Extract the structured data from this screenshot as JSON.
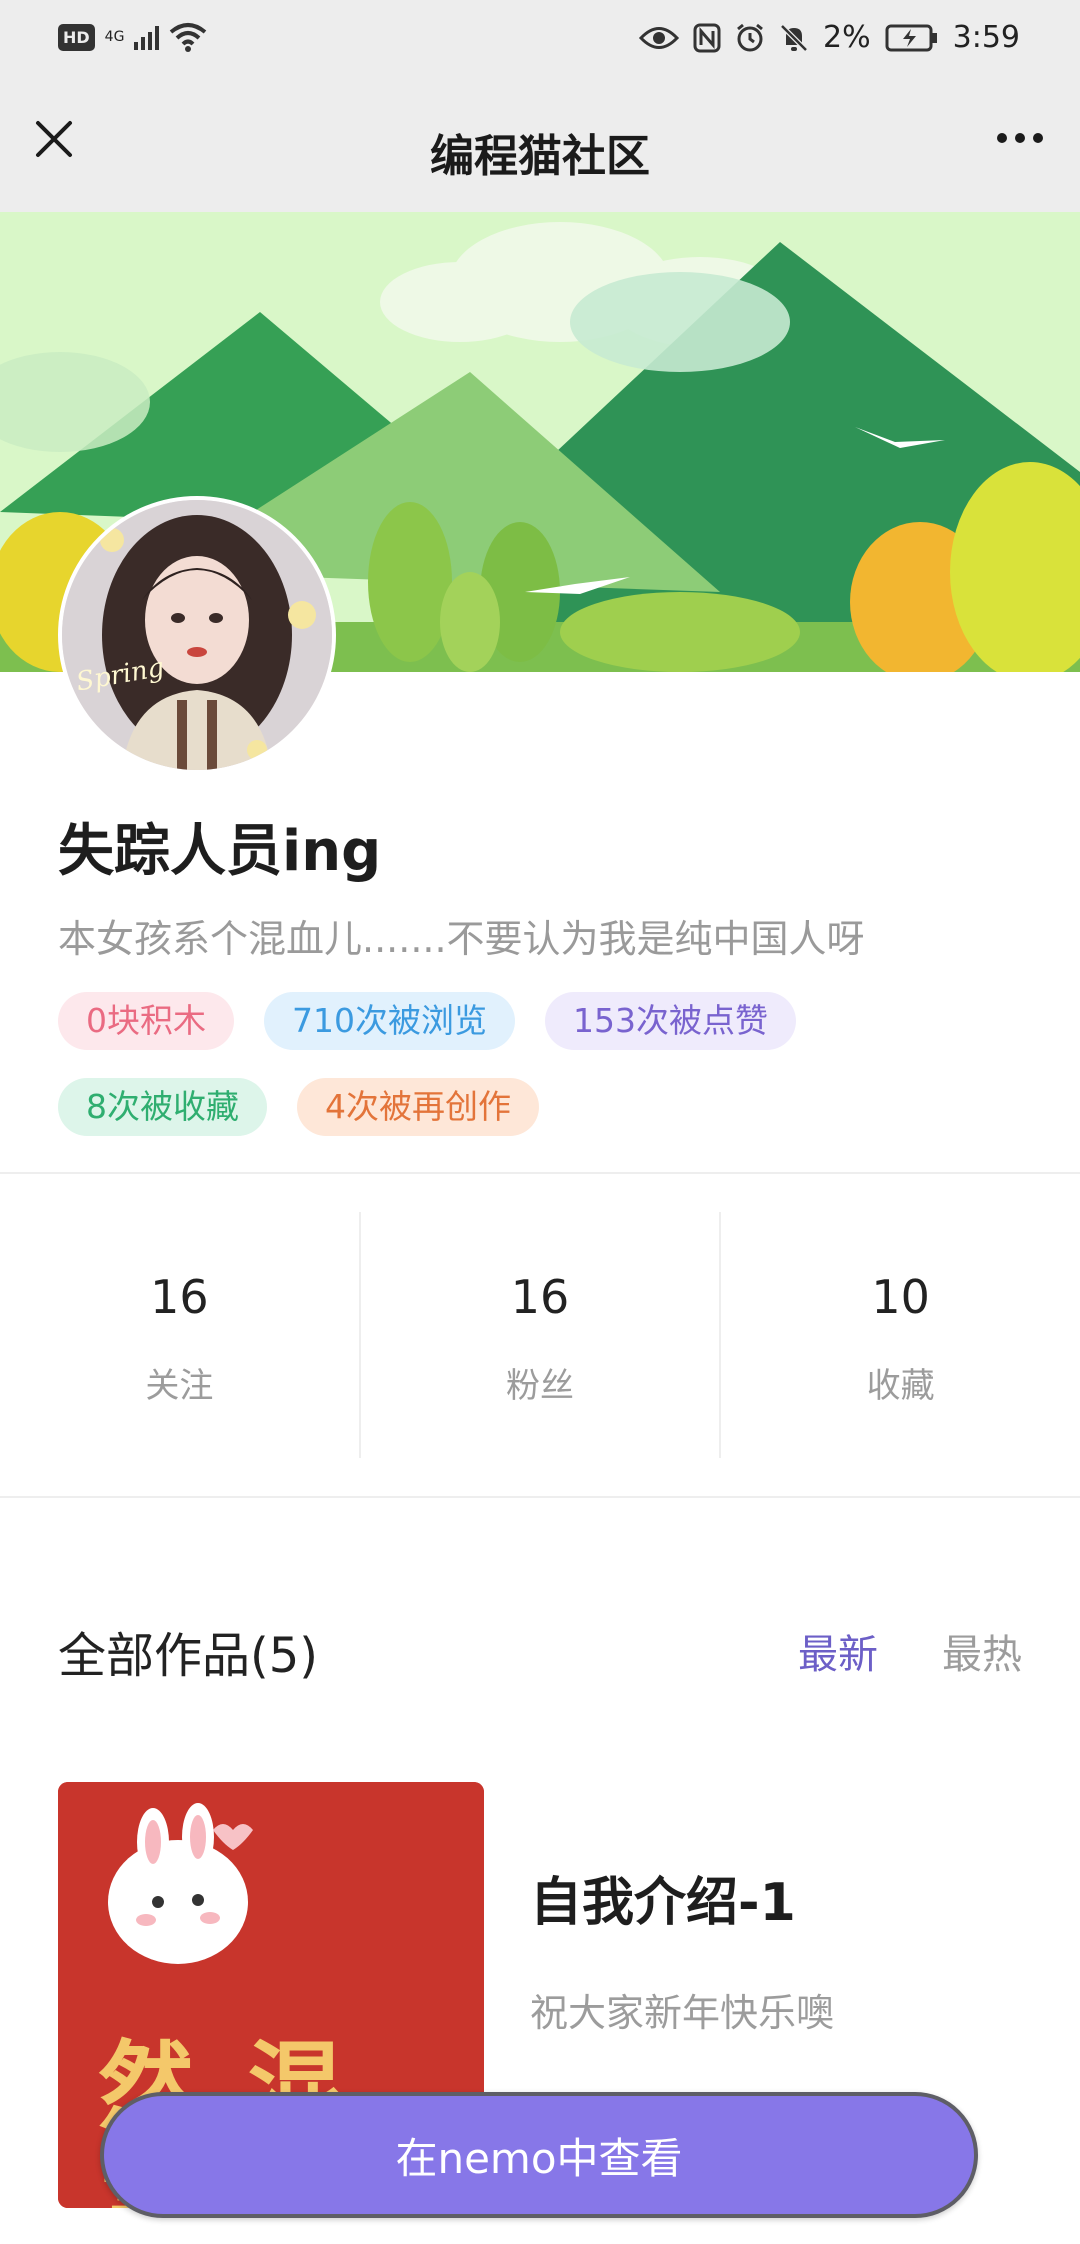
{
  "status_bar": {
    "hd": "HD",
    "network": "4G",
    "battery": "2%",
    "time": "3:59"
  },
  "navbar": {
    "title": "编程猫社区"
  },
  "profile": {
    "avatar_caption": "Spring",
    "username": "失踪人员ing",
    "bio": "本女孩系个混血儿.......不要认为我是纯中国人呀",
    "tags": [
      {
        "label": "0块积木",
        "bg": "#fde8ec",
        "color": "#ea6b82"
      },
      {
        "label": "710次被浏览",
        "bg": "#e1f1fd",
        "color": "#3b9ae0"
      },
      {
        "label": "153次被点赞",
        "bg": "#efebfc",
        "color": "#7963cf"
      },
      {
        "label": "8次被收藏",
        "bg": "#ddf5ea",
        "color": "#2fae70"
      },
      {
        "label": "4次被再创作",
        "bg": "#fee7d8",
        "color": "#e3743a"
      }
    ]
  },
  "stats": [
    {
      "num": "16",
      "label": "关注"
    },
    {
      "num": "16",
      "label": "粉丝"
    },
    {
      "num": "10",
      "label": "收藏"
    }
  ],
  "works": {
    "section_title": "全部作品(5)",
    "sort_new": "最新",
    "sort_hot": "最热",
    "items": [
      {
        "title": "自我介绍-1",
        "desc": "祝大家新年快乐噢",
        "thumb_text": "然 混 宫"
      }
    ]
  },
  "cta": {
    "label": "在nemo中查看"
  },
  "colors": {
    "accent": "#8777e8",
    "sort_active": "#6c5fc7"
  }
}
